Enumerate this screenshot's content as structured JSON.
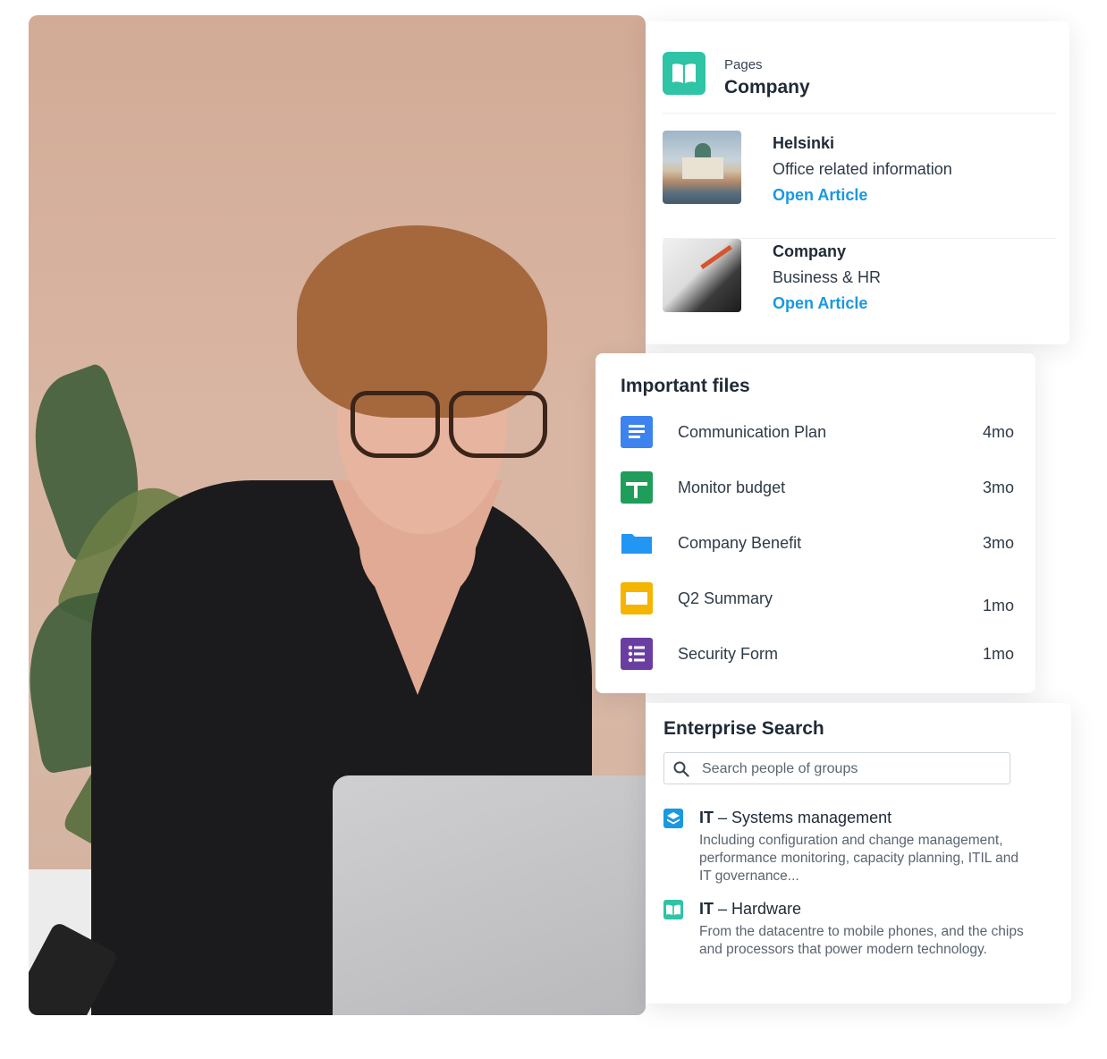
{
  "pages": {
    "label": "Pages",
    "title": "Company",
    "articles": [
      {
        "title": "Helsinki",
        "description": "Office related information",
        "link": "Open Article"
      },
      {
        "title": "Company",
        "description": "Business & HR",
        "link": "Open Article"
      }
    ]
  },
  "important_files": {
    "title": "Important files",
    "files": [
      {
        "name": "Communication Plan",
        "age": "4mo",
        "icon": "google-docs-icon",
        "color": "#3d83f0"
      },
      {
        "name": "Monitor budget",
        "age": "3mo",
        "icon": "google-sheets-icon",
        "color": "#1e9e5a"
      },
      {
        "name": "Company Benefit",
        "age": "3mo",
        "icon": "folder-icon",
        "color": "#2196f3"
      },
      {
        "name": "Q2 Summary",
        "age": "1mo",
        "icon": "google-slides-icon",
        "color": "#f4b400"
      },
      {
        "name": "Security Form",
        "age": "1mo",
        "icon": "google-forms-icon",
        "color": "#6a3ea1"
      }
    ]
  },
  "enterprise_search": {
    "title": "Enterprise Search",
    "placeholder": "Search people of groups",
    "results": [
      {
        "prefix": "IT",
        "sep": " – ",
        "name": "Systems management",
        "description": "Including configuration and change management, performance monitoring, capacity planning, ITIL and IT governance...",
        "icon": "layers-icon"
      },
      {
        "prefix": "IT",
        "sep": " – ",
        "name": "Hardware",
        "description": "From the datacentre to mobile phones, and the chips and processors that power modern technology.",
        "icon": "book-icon"
      }
    ]
  },
  "colors": {
    "accent_link": "#1a98e0",
    "pages_teal": "#2ec4a5"
  }
}
